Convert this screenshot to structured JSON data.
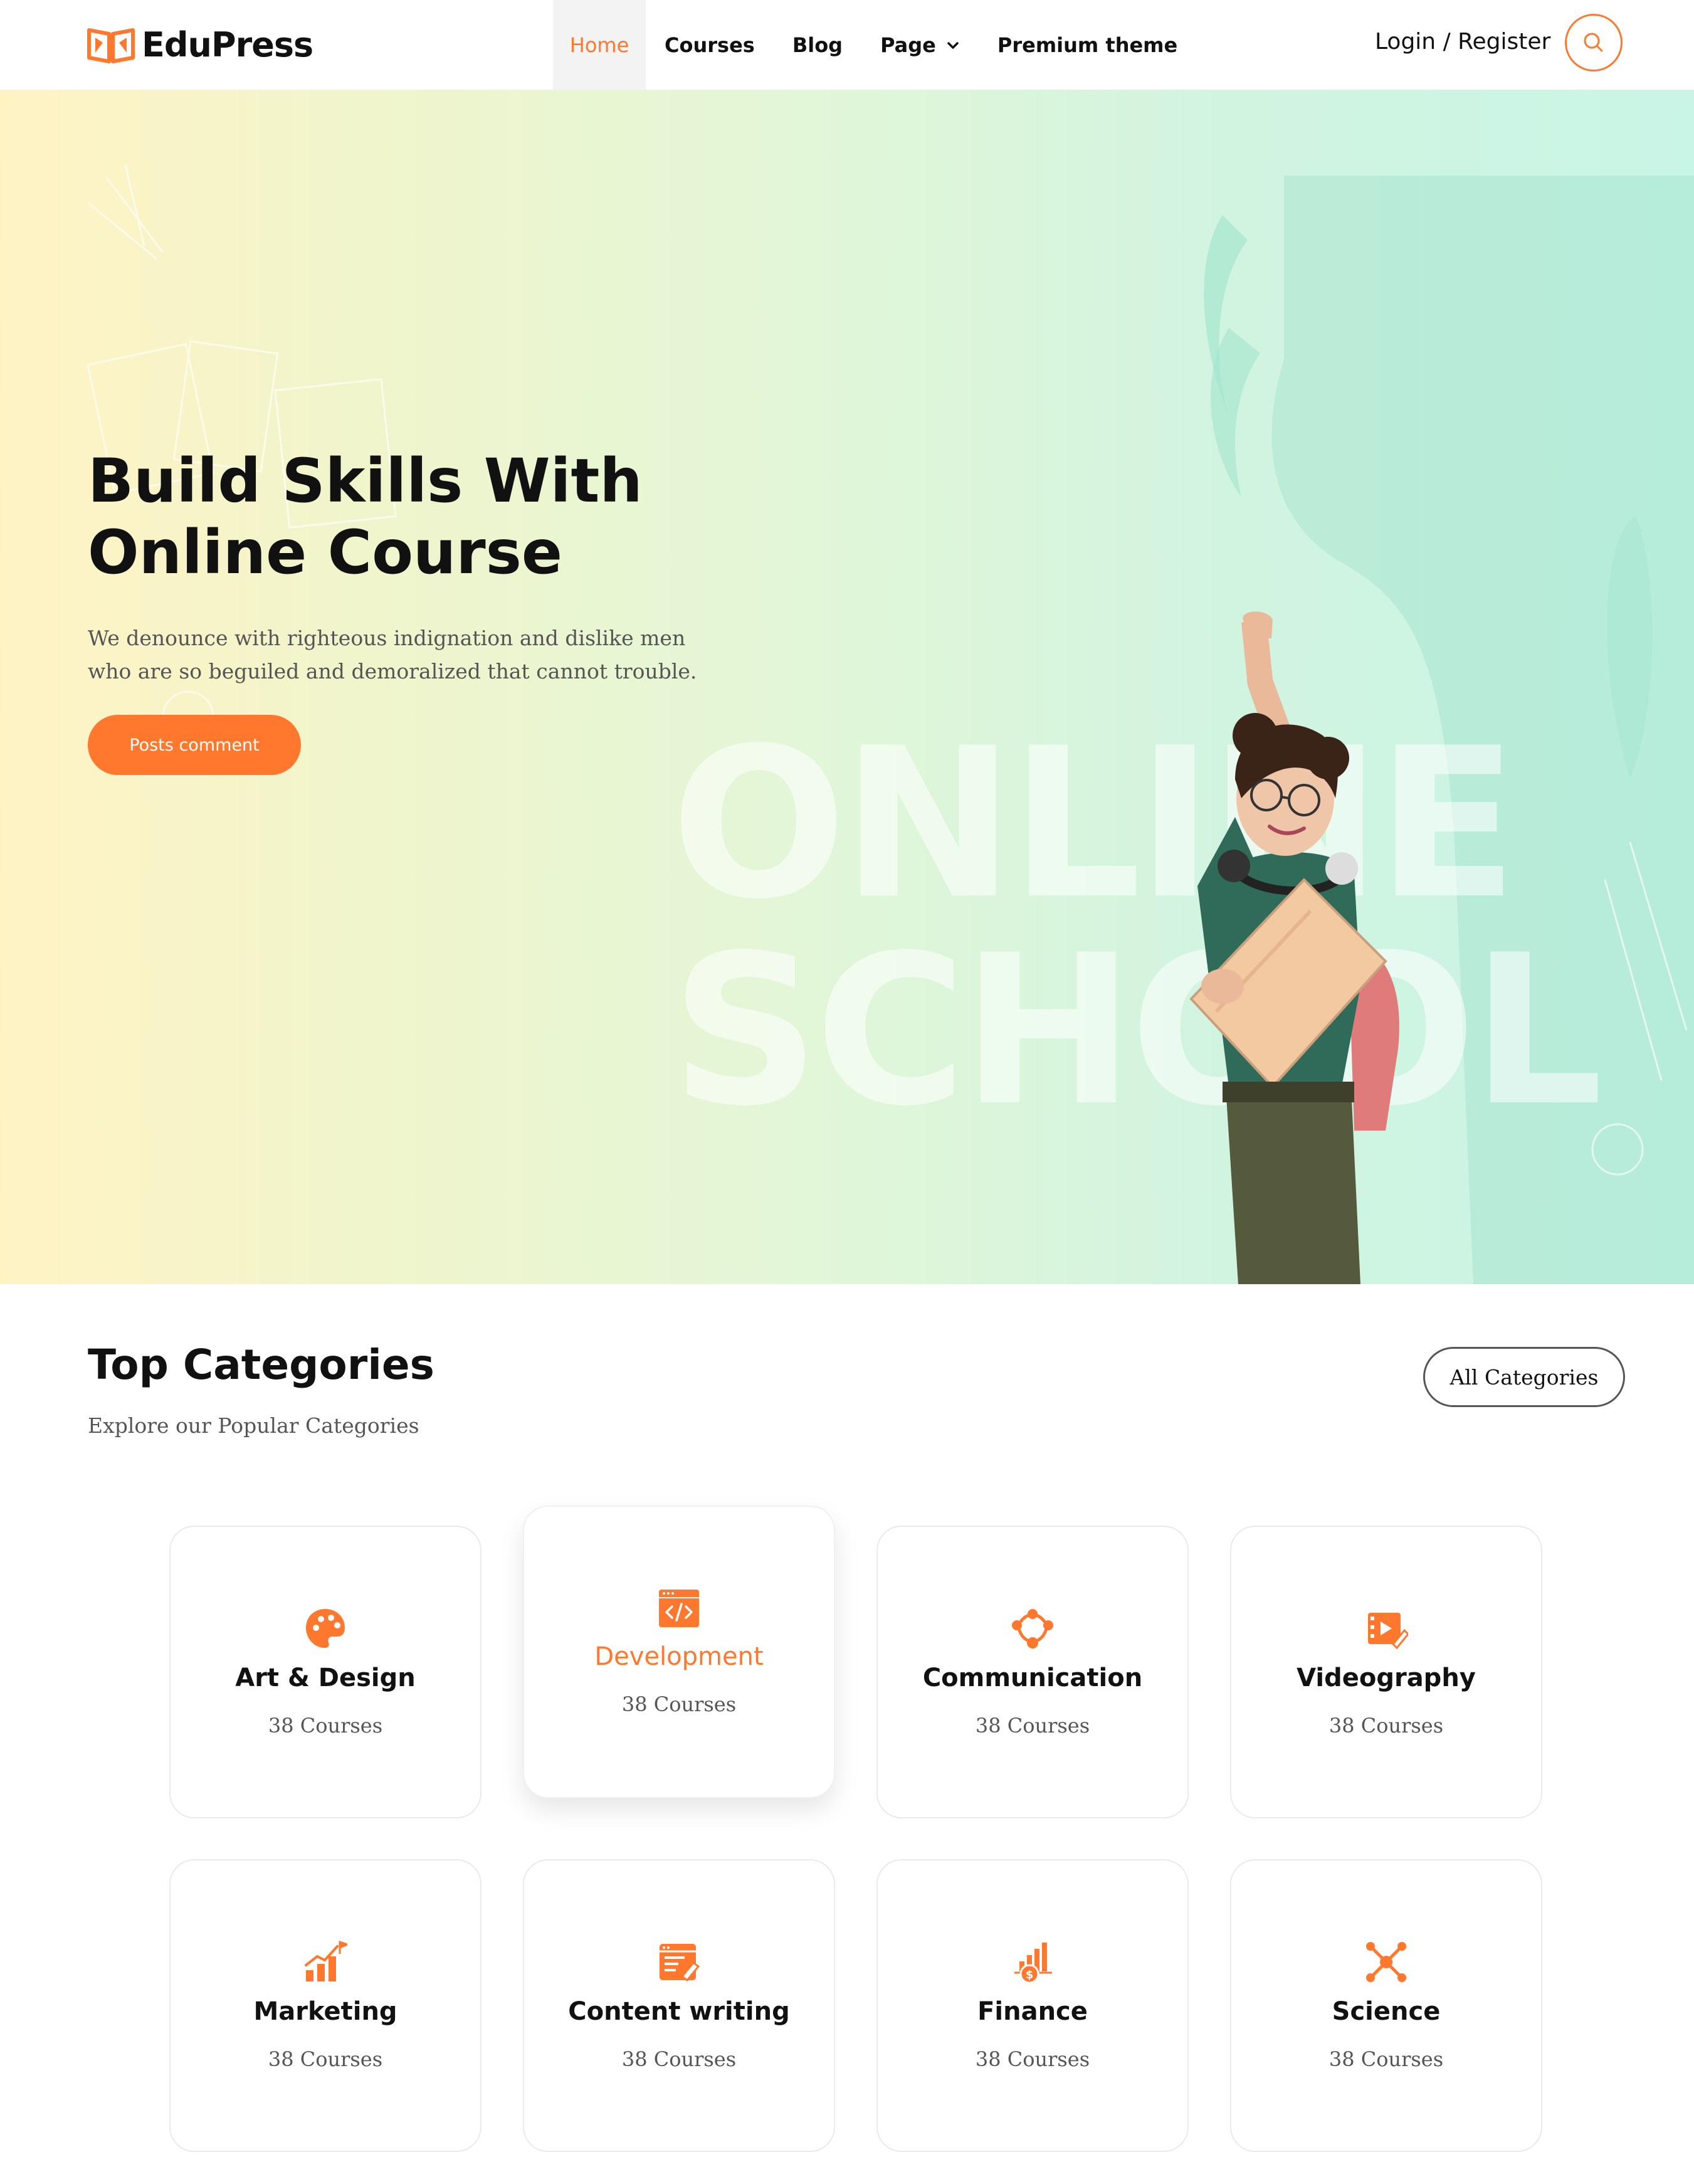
{
  "brand": {
    "name": "EduPress",
    "accent": "#ff782d"
  },
  "nav": {
    "items": [
      {
        "label": "Home",
        "active": true
      },
      {
        "label": "Courses"
      },
      {
        "label": "Blog"
      },
      {
        "label": "Page",
        "has_dropdown": true
      },
      {
        "label": "Premium theme"
      }
    ],
    "login_label": "Login / Register",
    "search_icon": "search-icon"
  },
  "hero": {
    "title_line1": "Build Skills With",
    "title_line2": "Online Course",
    "subtitle": "We denounce with righteous indignation and dislike men who are so beguiled and demoralized that cannot trouble.",
    "button_label": "Posts comment",
    "background_text": "ONLINE SCHOOL"
  },
  "categories": {
    "title": "Top Categories",
    "subtitle": "Explore our Popular Categories",
    "all_button": "All Categories",
    "items": [
      {
        "name": "Art & Design",
        "count": "38 Courses",
        "icon": "palette-icon"
      },
      {
        "name": "Development",
        "count": "38 Courses",
        "icon": "code-window-icon",
        "featured": true
      },
      {
        "name": "Communication",
        "count": "38 Courses",
        "icon": "people-network-icon"
      },
      {
        "name": "Videography",
        "count": "38 Courses",
        "icon": "video-edit-icon"
      },
      {
        "name": "Marketing",
        "count": "38 Courses",
        "icon": "growth-chart-icon"
      },
      {
        "name": "Content writing",
        "count": "38 Courses",
        "icon": "content-writing-icon"
      },
      {
        "name": "Finance",
        "count": "38 Courses",
        "icon": "finance-chart-icon"
      },
      {
        "name": "Science",
        "count": "38 Courses",
        "icon": "molecule-icon"
      }
    ]
  }
}
